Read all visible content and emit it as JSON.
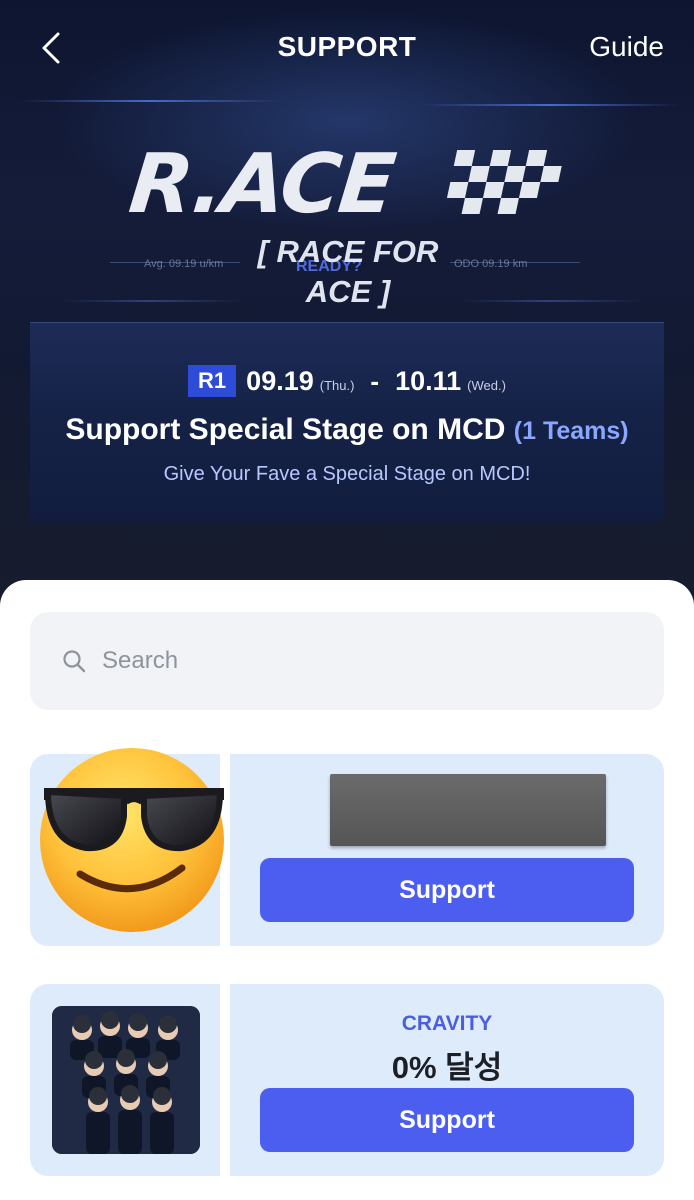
{
  "header": {
    "title": "SUPPORT",
    "guide_label": "Guide",
    "back_icon": "chevron-left-icon"
  },
  "hero": {
    "logo_text": "R.ACE",
    "tagline": "[ RACE FOR ACE ]",
    "hud_left": "Avg. 09.19 u/km",
    "hud_right": "ODO 09.19 km",
    "hud_center": "READY?",
    "round_badge": "R1",
    "start_date": "09.19",
    "start_day": "(Thu.)",
    "separator": "-",
    "end_date": "10.11",
    "end_day": "(Wed.)",
    "title": "Support Special Stage on MCD",
    "teams": "(1 Teams)",
    "subtitle": "Give Your Fave a Special Stage on MCD!"
  },
  "search": {
    "placeholder": "Search",
    "icon": "search-icon"
  },
  "cards": [
    {
      "thumb": "sunglasses-emoji",
      "support_label": "Support"
    },
    {
      "artist": "CRAVITY",
      "progress": "0% 달성",
      "support_label": "Support"
    }
  ],
  "colors": {
    "accent": "#4b5ef0",
    "card_bg": "#deebfb",
    "artist_text": "#4a5fe0",
    "hero_bg": "#121a33"
  }
}
